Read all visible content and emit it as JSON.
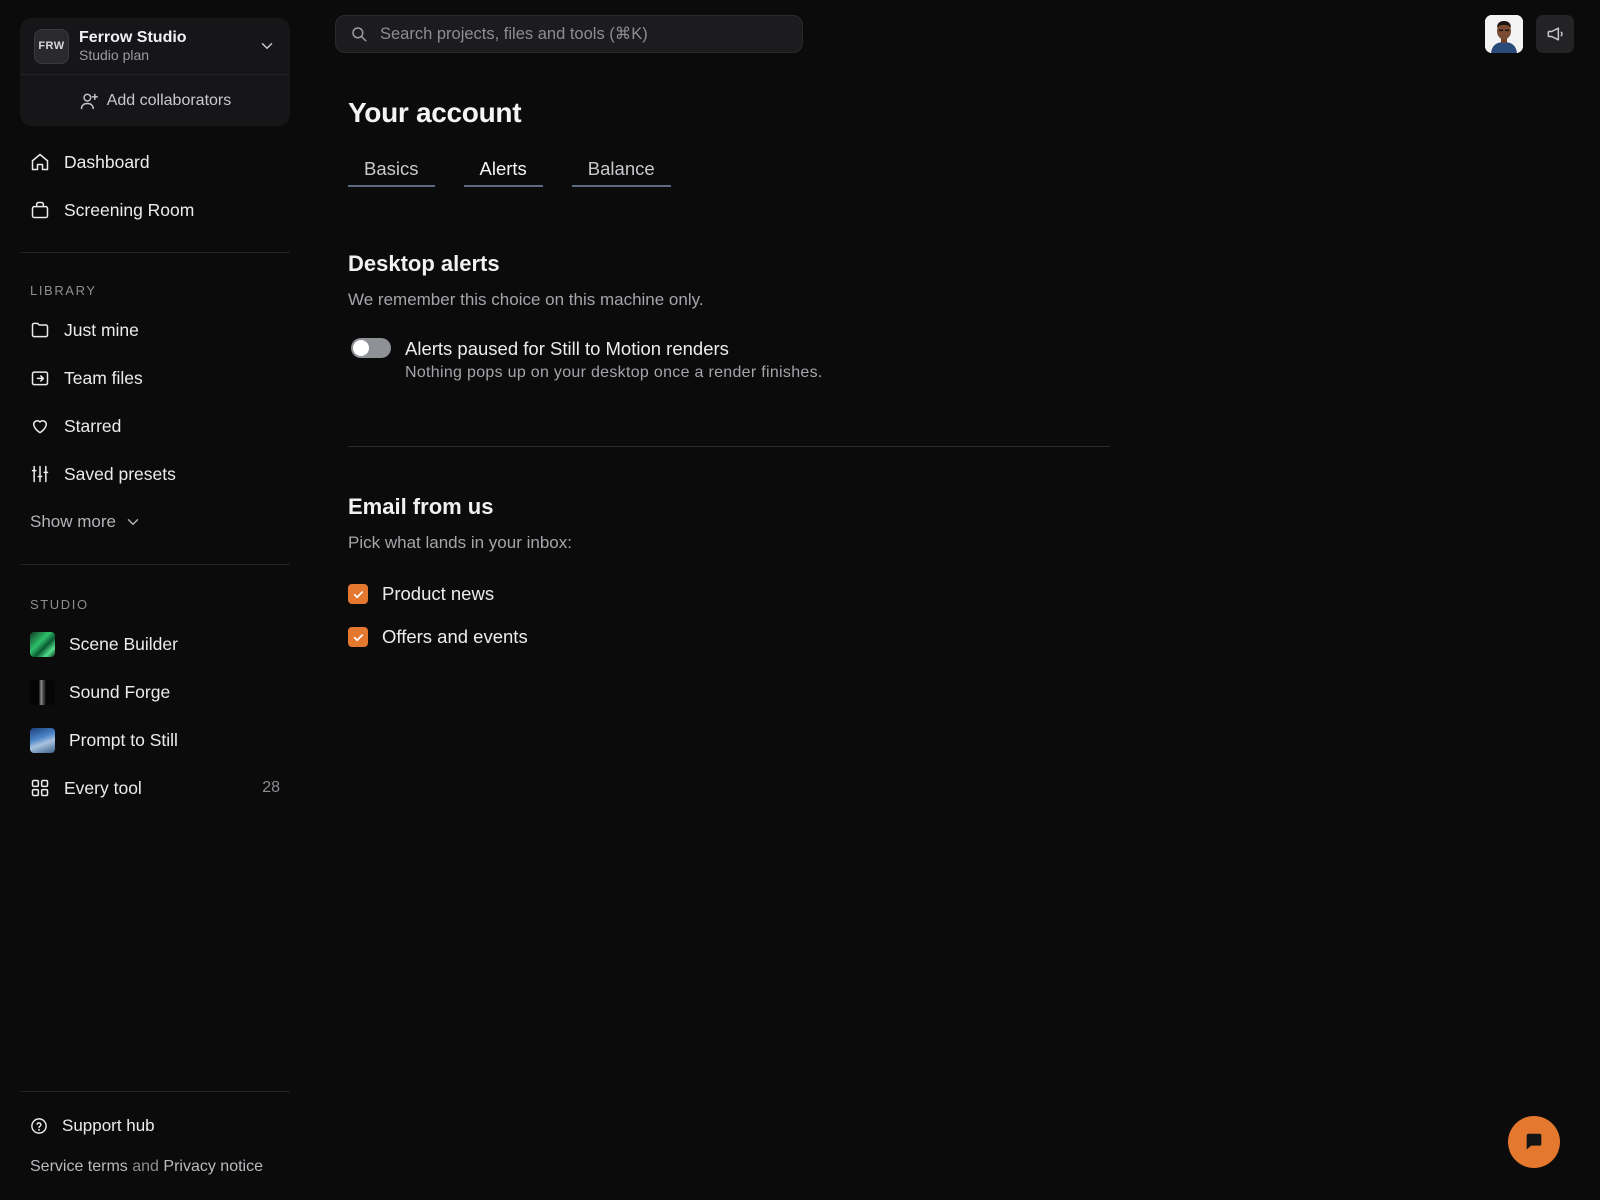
{
  "workspace": {
    "logo_text": "FRW",
    "name": "Ferrow Studio",
    "plan": "Studio plan",
    "add_collaborators": "Add collaborators"
  },
  "nav": {
    "primary": [
      {
        "label": "Dashboard",
        "icon": "home-icon"
      },
      {
        "label": "Screening Room",
        "icon": "bag-icon"
      }
    ],
    "library_heading": "LIBRARY",
    "library": [
      {
        "label": "Just mine",
        "icon": "folder-icon"
      },
      {
        "label": "Team files",
        "icon": "shared-folder-icon"
      },
      {
        "label": "Starred",
        "icon": "heart-icon"
      },
      {
        "label": "Saved presets",
        "icon": "sliders-icon"
      }
    ],
    "show_more": "Show more",
    "studio_heading": "STUDIO",
    "studio": [
      {
        "label": "Scene Builder",
        "icon": "scene-builder-thumbnail"
      },
      {
        "label": "Sound Forge",
        "icon": "sound-forge-thumbnail"
      },
      {
        "label": "Prompt to Still",
        "icon": "prompt-to-still-thumbnail"
      },
      {
        "label": "Every tool",
        "icon": "grid-icon",
        "count": "28"
      }
    ]
  },
  "footer": {
    "support": "Support hub",
    "service_terms": "Service terms",
    "and": "and",
    "privacy": "Privacy notice"
  },
  "search": {
    "placeholder": "Search projects, files and tools (⌘K)",
    "value": ""
  },
  "main": {
    "title": "Your account",
    "tabs": [
      {
        "label": "Basics",
        "active": false
      },
      {
        "label": "Alerts",
        "active": true
      },
      {
        "label": "Balance",
        "active": false
      }
    ],
    "desktop_alerts": {
      "title": "Desktop alerts",
      "subtitle": "We remember this choice on this machine only.",
      "toggle_label": "Alerts paused for Still to Motion renders",
      "toggle_desc": "Nothing pops up on your desktop once a render finishes.",
      "toggle_on": false
    },
    "email": {
      "title": "Email from us",
      "subtitle": "Pick what lands in your inbox:",
      "options": [
        {
          "label": "Product news",
          "checked": true
        },
        {
          "label": "Offers and events",
          "checked": true
        }
      ]
    }
  },
  "colors": {
    "accent": "#e5782f",
    "background": "#0b0b0c",
    "tab_underline": "#5b6a7e"
  }
}
